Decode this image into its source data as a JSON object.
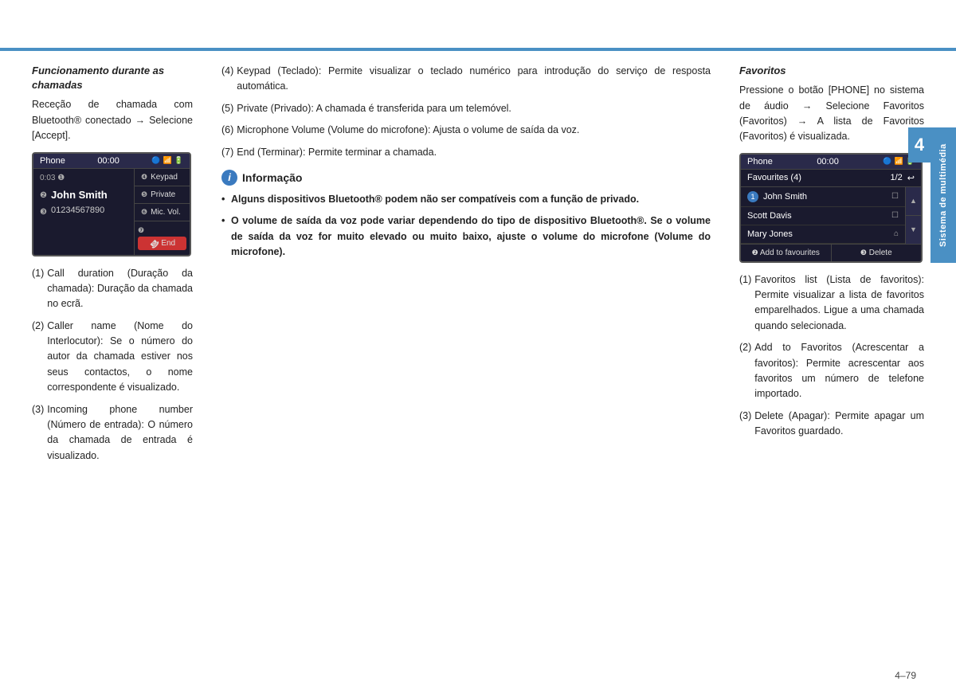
{
  "top_line": {},
  "left_col": {
    "section_title": "Funcionamento durante as chamadas",
    "intro_text": "Receção de chamada com Bluetooth® conectado → Selecione [Accept].",
    "phone_screen": {
      "header_label": "Phone",
      "header_time": "00:00",
      "call_duration": "0:03",
      "duration_num": "❶",
      "circle4": "❹",
      "circle5": "❺",
      "circle6": "❻",
      "circle7": "❼",
      "caller_name": "John Smith",
      "caller_name_num": "❷",
      "caller_number": "01234567890",
      "caller_number_num": "❸",
      "btn_keypad": "Keypad",
      "btn_private": "Private",
      "btn_mic": "Mic. Vol.",
      "btn_end": "End",
      "end_icon": "☎"
    },
    "items": [
      {
        "num": "(1)",
        "text": "Call duration (Duração da chamada): Duração da chamada no ecrã."
      },
      {
        "num": "(2)",
        "text": "Caller name (Nome do Interlocutor): Se o número do autor da chamada estiver nos seus contactos, o nome correspondente é visualizado."
      },
      {
        "num": "(3)",
        "text": "Incoming phone number (Número de entrada): O número da chamada de entrada é visualizado."
      }
    ]
  },
  "mid_col": {
    "items": [
      {
        "num": "(4)",
        "text": "Keypad (Teclado): Permite visualizar o teclado numérico para introdução do serviço de resposta automática."
      },
      {
        "num": "(5)",
        "text": "Private (Privado): A chamada é transferida para um telemóvel."
      },
      {
        "num": "(6)",
        "text": "Microphone Volume (Volume do microfone): Ajusta o volume de saída da voz."
      },
      {
        "num": "(7)",
        "text": "End (Terminar): Permite terminar a chamada."
      }
    ],
    "info_title": "Informação",
    "info_icon": "i",
    "bullets": [
      "Alguns dispositivos Bluetooth® podem não ser compatíveis com a função de privado.",
      "O volume de saída da voz pode variar dependendo do tipo de dispositivo Bluetooth®. Se o volume de saída da voz for muito elevado ou muito baixo, ajuste o volume do microfone (Volume do microfone)."
    ]
  },
  "right_col": {
    "section_title": "Favoritos",
    "intro_text": "Pressione o botão [PHONE] no sistema de áudio → Selecione Favoritos (Favoritos) → A lista de Favoritos (Favoritos) é visualizada.",
    "phone_screen": {
      "header_label": "Phone",
      "header_time": "00:00",
      "sub_label": "Favourites (4)",
      "sub_pages": "1/2",
      "back_icon": "↩",
      "contacts": [
        {
          "name": "John Smith",
          "icon": "☐",
          "num": "❶"
        },
        {
          "name": "Scott Davis",
          "icon": "☐"
        },
        {
          "name": "Mary Jones",
          "icon": "⌂"
        }
      ],
      "scroll_up": "▲",
      "scroll_down": "▼",
      "circle2": "❷",
      "circle3": "❸",
      "btn_add": "Add to favourites",
      "btn_delete": "Delete"
    },
    "items": [
      {
        "num": "(1)",
        "text": "Favoritos list (Lista de favoritos): Permite visualizar a lista de favoritos emparelhados.\nLigue a uma chamada quando selecionada."
      },
      {
        "num": "(2)",
        "text": "Add to Favoritos (Acrescentar a favoritos): Permite acrescentar aos favoritos um número de telefone importado."
      },
      {
        "num": "(3)",
        "text": "Delete (Apagar): Permite apagar um Favoritos guardado."
      }
    ]
  },
  "sidebar": {
    "number": "4",
    "label": "Sistema de multimédia"
  },
  "page_number": "4–79"
}
